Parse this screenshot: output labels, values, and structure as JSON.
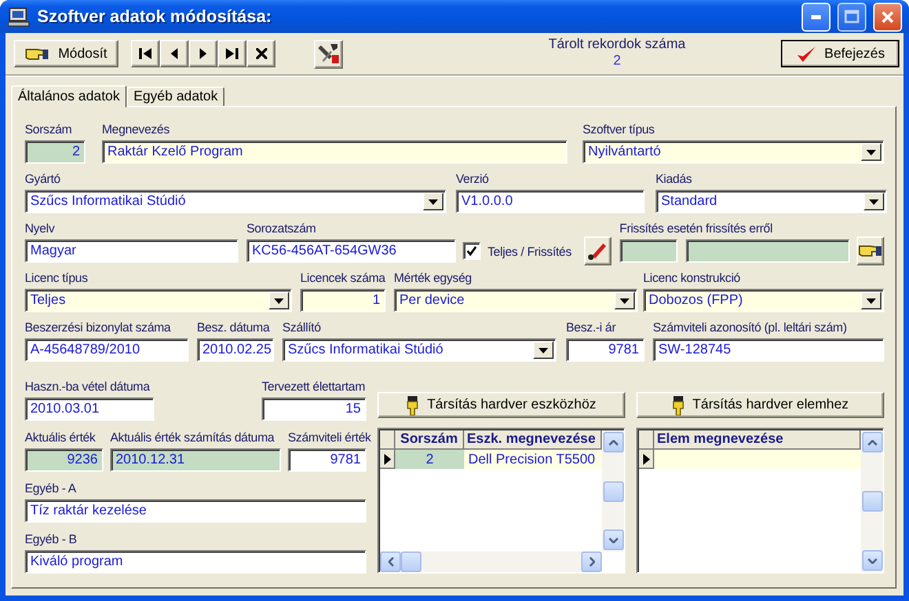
{
  "window": {
    "title": "Szoftver adatok módosítása:"
  },
  "toolbar": {
    "modify_button": "Módosít",
    "nav_buttons": [
      {
        "kind": "first"
      },
      {
        "kind": "prev"
      },
      {
        "kind": "next"
      },
      {
        "kind": "last"
      },
      {
        "kind": "delete"
      }
    ],
    "record_count_label": "Tárolt rekordok száma",
    "record_count": "2",
    "finish_button": "Befejezés"
  },
  "tabs": [
    {
      "label": "Általános adatok",
      "selected": true
    },
    {
      "label": "Egyéb adatok",
      "selected": false
    }
  ],
  "form_rows": [
    [
      {
        "kind": "number",
        "label": "Sorszám",
        "value": "2",
        "required": false,
        "read_only": true
      },
      {
        "kind": "text",
        "label": "Megnevezés",
        "value": "Raktár Kzelő Program",
        "required": true,
        "read_only": false
      },
      {
        "kind": "combo",
        "label": "Szoftver típus",
        "value": "Nyilvántartó",
        "required": true,
        "read_only": false
      }
    ],
    [
      {
        "kind": "combo",
        "label": "Gyártó",
        "value": "Szűcs Informatikai Stúdió",
        "required": false,
        "read_only": false
      },
      {
        "kind": "text",
        "label": "Verzió",
        "value": "V1.0.0.0",
        "required": false,
        "read_only": false
      },
      {
        "kind": "combo",
        "label": "Kiadás",
        "value": "Standard",
        "required": false,
        "read_only": false
      }
    ],
    [
      {
        "kind": "text",
        "label": "Nyelv",
        "value": "Magyar",
        "required": false,
        "read_only": false
      },
      {
        "kind": "text",
        "label": "Sorozatszám",
        "value": "KC56-456AT-654GW36",
        "required": false,
        "read_only": false
      },
      {
        "kind": "checkbox",
        "label": "Teljes / Frissítés",
        "checked": true
      },
      {
        "kind": "edit_button"
      },
      {
        "kind": "update_pair",
        "label": "Frissítés esetén frissítés erről",
        "required": false,
        "read_only": true
      },
      {
        "kind": "pick_button"
      }
    ],
    [
      {
        "kind": "combo",
        "label": "Licenc típus",
        "value": "Teljes",
        "required": true,
        "read_only": false
      },
      {
        "kind": "number",
        "label": "Licencek száma",
        "value": "1",
        "required": true,
        "read_only": false
      },
      {
        "kind": "combo",
        "label": "Mérték egység",
        "value": "Per device",
        "required": true,
        "read_only": false
      },
      {
        "kind": "combo",
        "label": "Licenc konstrukció",
        "value": "Dobozos (FPP)",
        "required": true,
        "read_only": false
      }
    ],
    [
      {
        "kind": "text",
        "label": "Beszerzési bizonylat száma",
        "value": "A-45648789/2010",
        "required": false,
        "read_only": false
      },
      {
        "kind": "text",
        "label": "Besz. dátuma",
        "value": "2010.02.25",
        "required": false,
        "read_only": false
      },
      {
        "kind": "combo",
        "label": "Szállító",
        "value": "Szűcs Informatikai Stúdió",
        "required": false,
        "read_only": false
      },
      {
        "kind": "number",
        "label": "Besz.-i ár",
        "value": "9781",
        "required": false,
        "read_only": false
      },
      {
        "kind": "text",
        "label": "Számviteli azonosító (pl. leltári szám)",
        "value": "SW-128745",
        "required": false,
        "read_only": false
      }
    ]
  ],
  "left_rows": [
    [
      {
        "kind": "text",
        "label": "Haszn.-ba vétel dátuma",
        "value": "2010.03.01",
        "required": false,
        "read_only": false
      },
      {
        "kind": "number",
        "label": "Tervezett élettartam",
        "value": "15",
        "required": false,
        "read_only": false
      }
    ],
    [
      {
        "kind": "number",
        "label": "Aktuális érték",
        "value": "9236",
        "required": false,
        "read_only": true
      },
      {
        "kind": "text",
        "label": "Aktuális érték számítás dátuma",
        "value": "2010.12.31",
        "required": false,
        "read_only": true
      },
      {
        "kind": "number",
        "label": "Számviteli érték",
        "value": "9781",
        "required": false,
        "read_only": false
      }
    ],
    [
      {
        "kind": "text",
        "label": "Egyéb - A",
        "value": "Tíz raktár kezelése",
        "required": false,
        "read_only": false
      }
    ],
    [
      {
        "kind": "text",
        "label": "Egyéb - B",
        "value": "Kiváló program",
        "required": false,
        "read_only": false
      }
    ]
  ],
  "assoc_buttons": [
    "Társítás hardver eszközhöz",
    "Társítás hardver elemhez"
  ],
  "grids": [
    {
      "columns": [
        "Sorszám",
        "Eszk. megnevezése"
      ],
      "rows": [
        {
          "cells": [
            "2",
            "Dell Precision T5500"
          ],
          "current": true
        }
      ]
    },
    {
      "columns": [
        "Elem megnevezése"
      ],
      "rows": [
        {
          "current": true
        }
      ]
    }
  ]
}
